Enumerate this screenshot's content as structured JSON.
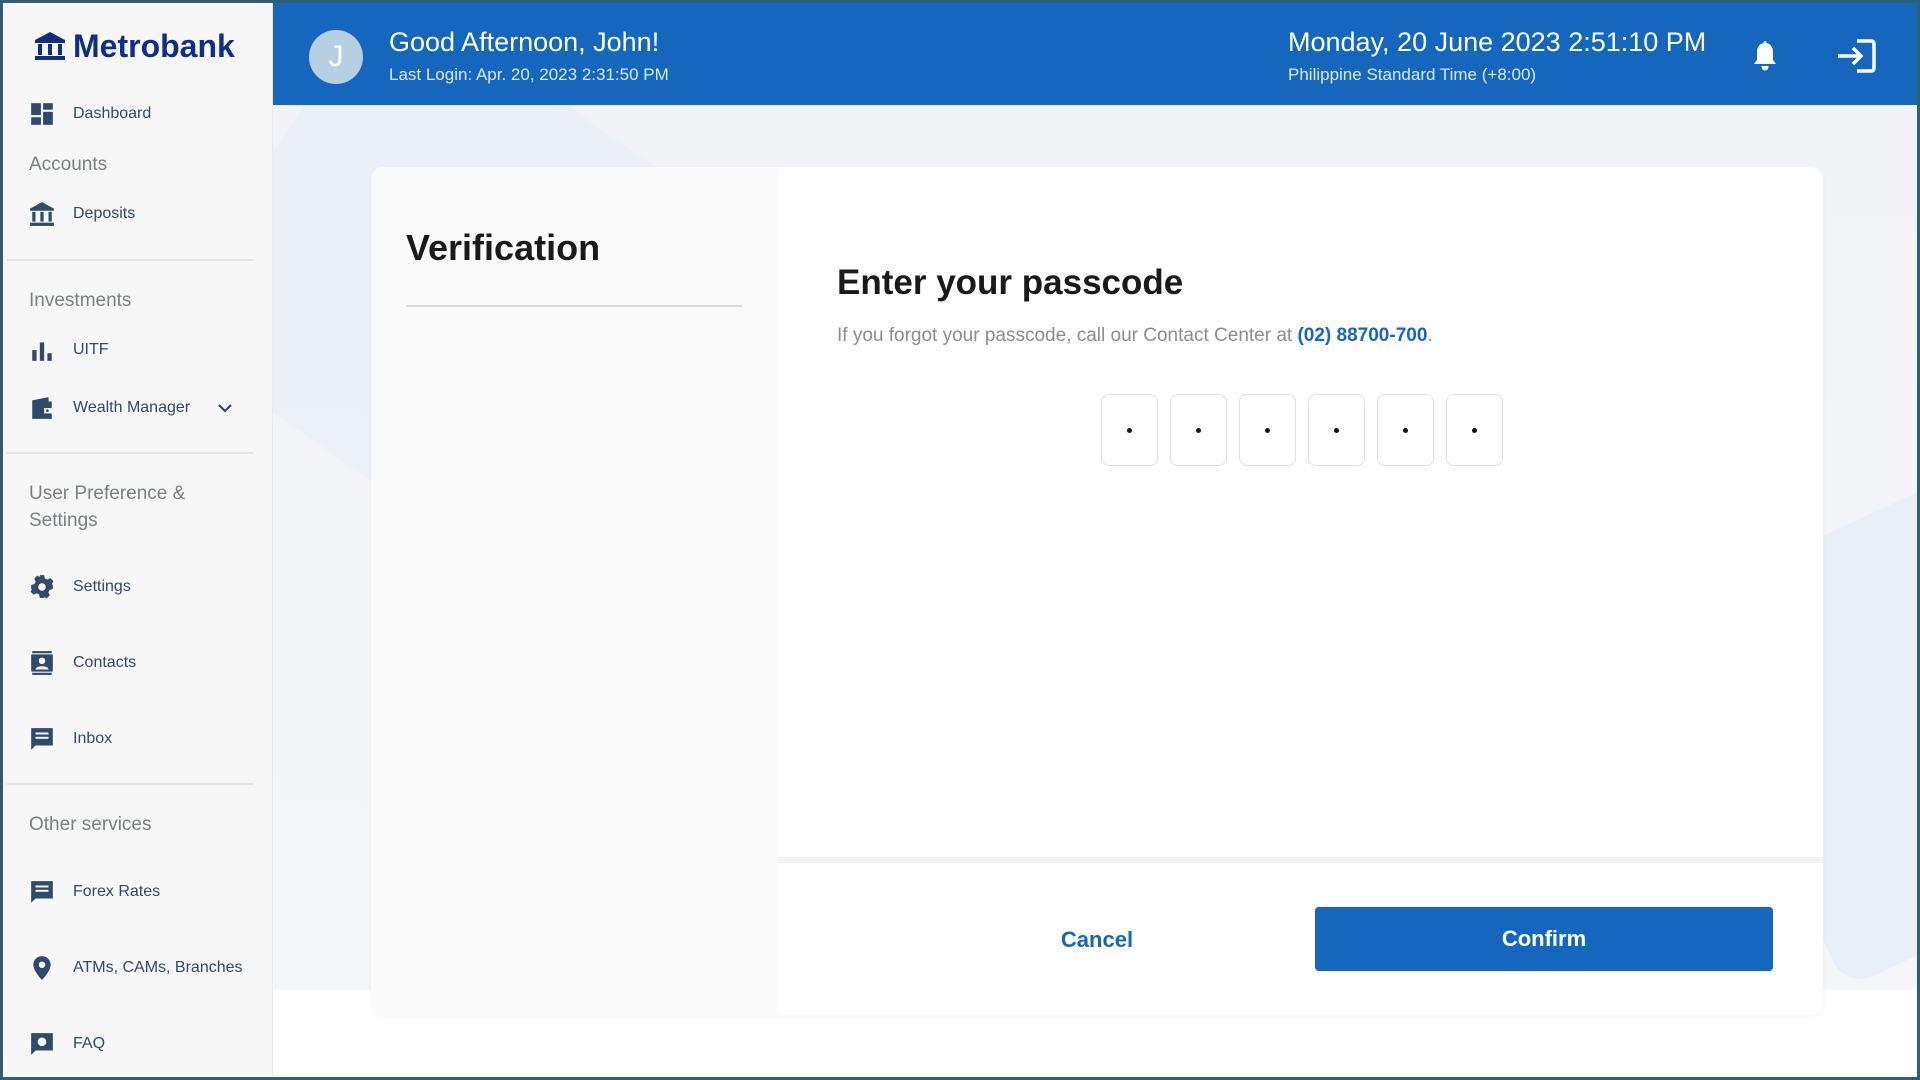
{
  "brand": {
    "name": "Metrobank",
    "color": "#0f2f84"
  },
  "sidebar": {
    "dashboard": {
      "label": "Dashboard",
      "icon": "dashboard-icon"
    },
    "accounts_label": "Accounts",
    "deposits": {
      "label": "Deposits",
      "icon": "bank-icon"
    },
    "investments_label": "Investments",
    "uitf": {
      "label": "UITF",
      "icon": "bar-chart-icon"
    },
    "wealth_manager": {
      "label": "Wealth Manager",
      "icon": "wallet-icon"
    },
    "preferences_label": "User Preference & Settings",
    "settings": {
      "label": "Settings",
      "icon": "gear-icon"
    },
    "contacts": {
      "label": "Contacts",
      "icon": "contacts-icon"
    },
    "inbox": {
      "label": "Inbox",
      "icon": "message-icon"
    },
    "other_label": "Other services",
    "forex": {
      "label": "Forex Rates",
      "icon": "message-icon"
    },
    "atms": {
      "label": "ATMs, CAMs, Branches",
      "icon": "location-pin-icon"
    },
    "faq": {
      "label": "FAQ",
      "icon": "faq-icon"
    }
  },
  "header": {
    "avatar_initial": "J",
    "greeting": "Good Afternoon, John!",
    "last_login": "Last Login: Apr. 20, 2023 2:31:50 PM",
    "datetime": "Monday, 20 June 2023 2:51:10 PM",
    "timezone": "Philippine Standard Time (+8:00)",
    "bg_color": "#1467bd"
  },
  "card": {
    "title": "Verification",
    "passcode_title": "Enter your passcode",
    "hint_text": "If you forgot your passcode, call our Contact Center at ",
    "hint_phone": "(02) 88700-700",
    "hint_end": ".",
    "pin_count": 6,
    "cancel_label": "Cancel",
    "confirm_label": "Confirm"
  }
}
